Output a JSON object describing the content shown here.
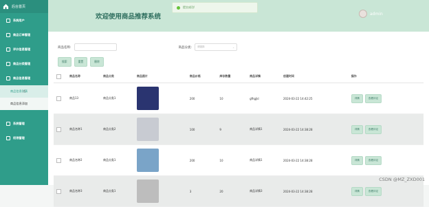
{
  "app": {
    "brand": "后台首页"
  },
  "sidebar": {
    "items": [
      {
        "label": "系统用户",
        "icon": "gear-icon"
      },
      {
        "label": "商品订单管理",
        "icon": "list-icon"
      },
      {
        "label": "评价信息管理",
        "icon": "doc-icon"
      },
      {
        "label": "商品分类管理",
        "icon": "doc-icon"
      },
      {
        "label": "商品信息管理",
        "icon": "box-icon"
      }
    ],
    "subitems": [
      {
        "label": "商品信息列表"
      },
      {
        "label": "商品信息添加"
      }
    ],
    "items2": [
      {
        "label": "系统管理",
        "icon": "grid-icon"
      },
      {
        "label": "权限管理",
        "icon": "lock-icon"
      }
    ]
  },
  "header": {
    "title": "欢迎使用商品推荐系统",
    "user": "admin",
    "toast": "提交成功!"
  },
  "search": {
    "name_label": "商品名称:",
    "cat_label": "商品分类:",
    "cat_placeholder": "请选择"
  },
  "buttons": {
    "search": "搜索",
    "reset": "重置",
    "delete": "删除"
  },
  "table": {
    "headers": [
      "商品名称",
      "商品分类",
      "商品图片",
      "商品价格",
      "库存数量",
      "商品详情",
      "创建时间",
      "操作"
    ],
    "rows": [
      {
        "name": "商品13",
        "cat": "商品分类1",
        "price": "200",
        "stock": "10",
        "detail": "gfhgjkl",
        "time": "2024-03-22 14:42:25"
      },
      {
        "name": "商品名称1",
        "cat": "商品分类2",
        "price": "100",
        "stock": "9",
        "detail": "商品详情1",
        "time": "2024-03-22 14:38:28"
      },
      {
        "name": "商品名称2",
        "cat": "商品分类1",
        "price": "200",
        "stock": "10",
        "detail": "商品详情1",
        "time": "2024-03-22 14:38:28"
      },
      {
        "name": "商品名称3",
        "cat": "商品分类1",
        "price": "3",
        "stock": "20",
        "detail": "商品详情3",
        "time": "2024-03-22 14:38:28"
      }
    ],
    "ops": [
      "详情",
      "查看评论"
    ]
  },
  "watermark": "CSDN @MZ_ZXD001"
}
